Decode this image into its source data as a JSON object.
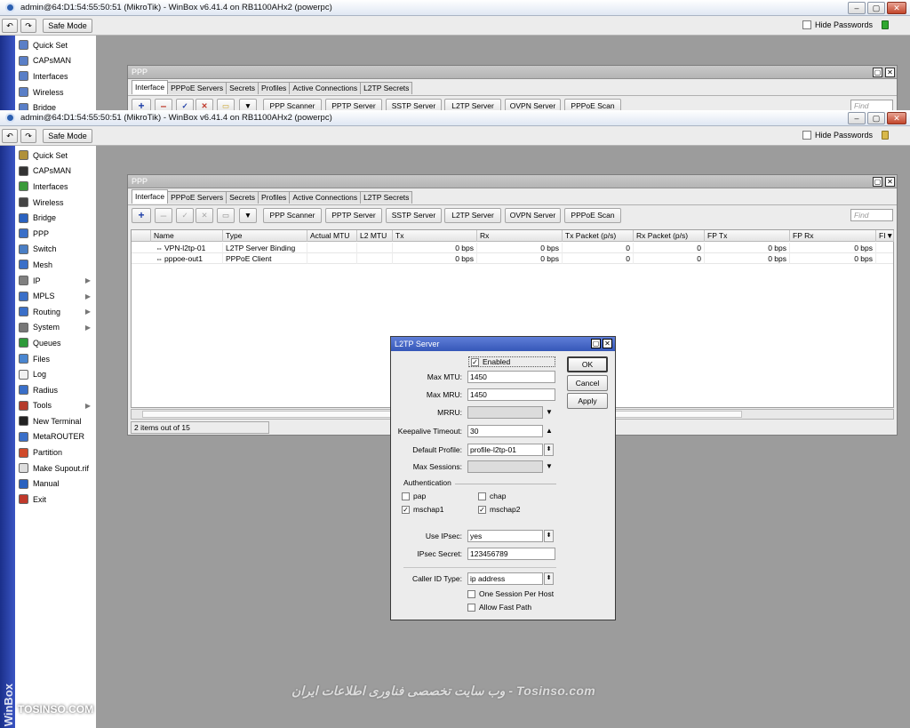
{
  "back_window": {
    "title": "admin@64:D1:54:55:50:51 (MikroTik) - WinBox v6.41.4 on RB1100AHx2 (powerpc)",
    "safe_mode": "Safe Mode",
    "hide_passwords": "Hide Passwords",
    "menu": [
      "Quick Set",
      "CAPsMAN",
      "Interfaces",
      "Wireless",
      "Bridge"
    ],
    "ppp_title": "PPP",
    "tabs": [
      "Interface",
      "PPPoE Servers",
      "Secrets",
      "Profiles",
      "Active Connections",
      "L2TP Secrets"
    ],
    "toolbar": [
      "PPP Scanner",
      "PPTP Server",
      "SSTP Server",
      "L2TP Server",
      "OVPN Server",
      "PPPoE Scan"
    ],
    "find": "Find"
  },
  "window": {
    "title": "admin@64:D1:54:55:50:51 (MikroTik) - WinBox v6.41.4 on RB1100AHx2 (powerpc)",
    "undo": "↶",
    "redo": "↷",
    "safe_mode": "Safe Mode",
    "hide_passwords": "Hide Passwords",
    "min": "–",
    "max": "▢",
    "close": "✕"
  },
  "sidebar": {
    "vertical_text": "WinBox",
    "items": [
      {
        "label": "Quick Set",
        "icon": "wand-icon",
        "color": "#b0913a"
      },
      {
        "label": "CAPsMAN",
        "icon": "antenna-icon",
        "color": "#333333"
      },
      {
        "label": "Interfaces",
        "icon": "interfaces-icon",
        "color": "#3a9a3a"
      },
      {
        "label": "Wireless",
        "icon": "wireless-icon",
        "color": "#444444"
      },
      {
        "label": "Bridge",
        "icon": "bridge-icon",
        "color": "#2a62c0"
      },
      {
        "label": "PPP",
        "icon": "ppp-icon",
        "color": "#3a6fc8"
      },
      {
        "label": "Switch",
        "icon": "switch-icon",
        "color": "#4a7ec4"
      },
      {
        "label": "Mesh",
        "icon": "mesh-icon",
        "color": "#3a6fc8"
      },
      {
        "label": "IP",
        "icon": "ip-icon",
        "color": "#808080",
        "arrow": "▶"
      },
      {
        "label": "MPLS",
        "icon": "mpls-icon",
        "color": "#3a6fc8",
        "arrow": "▶"
      },
      {
        "label": "Routing",
        "icon": "routing-icon",
        "color": "#3a6fc8",
        "arrow": "▶"
      },
      {
        "label": "System",
        "icon": "system-icon",
        "color": "#777777",
        "arrow": "▶"
      },
      {
        "label": "Queues",
        "icon": "queues-icon",
        "color": "#2e9a3a"
      },
      {
        "label": "Files",
        "icon": "files-icon",
        "color": "#4a86d0"
      },
      {
        "label": "Log",
        "icon": "log-icon",
        "color": "#f1f1f1"
      },
      {
        "label": "Radius",
        "icon": "radius-icon",
        "color": "#3a6fc8"
      },
      {
        "label": "Tools",
        "icon": "tools-icon",
        "color": "#b53b2b",
        "arrow": "▶"
      },
      {
        "label": "New Terminal",
        "icon": "terminal-icon",
        "color": "#222222"
      },
      {
        "label": "MetaROUTER",
        "icon": "metarouter-icon",
        "color": "#3a6fc8"
      },
      {
        "label": "Partition",
        "icon": "partition-icon",
        "color": "#d04a2a"
      },
      {
        "label": "Make Supout.rif",
        "icon": "supout-icon",
        "color": "#dddddd"
      },
      {
        "label": "Manual",
        "icon": "manual-icon",
        "color": "#2a62c0"
      },
      {
        "label": "Exit",
        "icon": "exit-icon",
        "color": "#c0392b"
      }
    ]
  },
  "ppp": {
    "title": "PPP",
    "restore": "▢",
    "close": "✕",
    "tabs": [
      "Interface",
      "PPPoE Servers",
      "Secrets",
      "Profiles",
      "Active Connections",
      "L2TP Secrets"
    ],
    "toolbar": {
      "add": "+",
      "remove": "–",
      "enable": "✓",
      "disable": "✕",
      "comment": "▭",
      "filter": "▼",
      "buttons": [
        "PPP Scanner",
        "PPTP Server",
        "SSTP Server",
        "L2TP Server",
        "OVPN Server",
        "PPPoE Scan"
      ],
      "find_placeholder": "Find"
    },
    "columns": [
      "Name",
      "Type",
      "Actual MTU",
      "L2 MTU",
      "Tx",
      "Rx",
      "Tx Packet (p/s)",
      "Rx Packet (p/s)",
      "FP Tx",
      "FP Rx",
      "FI"
    ],
    "rows": [
      {
        "name": "VPN-l2tp-01",
        "type": "L2TP Server Binding",
        "actual_mtu": "",
        "l2_mtu": "",
        "tx": "0 bps",
        "rx": "0 bps",
        "tx_pps": "0",
        "rx_pps": "0",
        "fp_tx": "0 bps",
        "fp_rx": "0 bps"
      },
      {
        "name": "pppoe-out1",
        "type": "PPPoE Client",
        "actual_mtu": "",
        "l2_mtu": "",
        "tx": "0 bps",
        "rx": "0 bps",
        "tx_pps": "0",
        "rx_pps": "0",
        "fp_tx": "0 bps",
        "fp_rx": "0 bps"
      }
    ],
    "status": "2 items out of 15"
  },
  "l2tp": {
    "title": "L2TP Server",
    "restore": "▢",
    "close": "✕",
    "enabled_label": "Enabled",
    "enabled": true,
    "max_mtu_label": "Max MTU:",
    "max_mtu": "1450",
    "max_mru_label": "Max MRU:",
    "max_mru": "1450",
    "mrru_label": "MRRU:",
    "mrru": "",
    "keepalive_label": "Keepalive Timeout:",
    "keepalive": "30",
    "profile_label": "Default Profile:",
    "profile": "profile-l2tp-01",
    "max_sessions_label": "Max Sessions:",
    "max_sessions": "",
    "auth_section": "Authentication",
    "auth": [
      {
        "label": "pap",
        "checked": false
      },
      {
        "label": "chap",
        "checked": false
      },
      {
        "label": "mschap1",
        "checked": true
      },
      {
        "label": "mschap2",
        "checked": true
      }
    ],
    "use_ipsec_label": "Use IPsec:",
    "use_ipsec": "yes",
    "ipsec_secret_label": "IPsec Secret:",
    "ipsec_secret": "123456789",
    "caller_id_label": "Caller ID Type:",
    "caller_id": "ip address",
    "one_session_label": "One Session Per Host",
    "allow_fast_path_label": "Allow Fast Path",
    "ok": "OK",
    "cancel": "Cancel",
    "apply": "Apply",
    "check": "✓",
    "dd_arrow": "▼",
    "up_arrow": "▲",
    "dd_small": "⬍"
  },
  "overlay": {
    "watermark": "وب سایت تخصصی فناوری اطلاعات ایران - Tosinso.com",
    "logo": "TOSINSO.COM"
  }
}
